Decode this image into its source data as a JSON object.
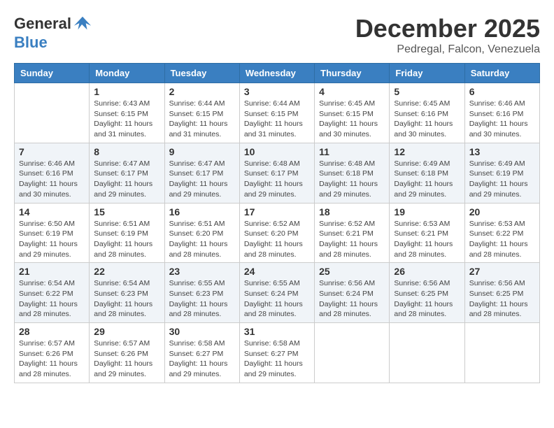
{
  "logo": {
    "general": "General",
    "blue": "Blue"
  },
  "title": {
    "month": "December 2025",
    "location": "Pedregal, Falcon, Venezuela"
  },
  "days_of_week": [
    "Sunday",
    "Monday",
    "Tuesday",
    "Wednesday",
    "Thursday",
    "Friday",
    "Saturday"
  ],
  "weeks": [
    [
      {
        "day": "",
        "info": ""
      },
      {
        "day": "1",
        "info": "Sunrise: 6:43 AM\nSunset: 6:15 PM\nDaylight: 11 hours and 31 minutes."
      },
      {
        "day": "2",
        "info": "Sunrise: 6:44 AM\nSunset: 6:15 PM\nDaylight: 11 hours and 31 minutes."
      },
      {
        "day": "3",
        "info": "Sunrise: 6:44 AM\nSunset: 6:15 PM\nDaylight: 11 hours and 31 minutes."
      },
      {
        "day": "4",
        "info": "Sunrise: 6:45 AM\nSunset: 6:15 PM\nDaylight: 11 hours and 30 minutes."
      },
      {
        "day": "5",
        "info": "Sunrise: 6:45 AM\nSunset: 6:16 PM\nDaylight: 11 hours and 30 minutes."
      },
      {
        "day": "6",
        "info": "Sunrise: 6:46 AM\nSunset: 6:16 PM\nDaylight: 11 hours and 30 minutes."
      }
    ],
    [
      {
        "day": "7",
        "info": "Sunrise: 6:46 AM\nSunset: 6:16 PM\nDaylight: 11 hours and 30 minutes."
      },
      {
        "day": "8",
        "info": "Sunrise: 6:47 AM\nSunset: 6:17 PM\nDaylight: 11 hours and 29 minutes."
      },
      {
        "day": "9",
        "info": "Sunrise: 6:47 AM\nSunset: 6:17 PM\nDaylight: 11 hours and 29 minutes."
      },
      {
        "day": "10",
        "info": "Sunrise: 6:48 AM\nSunset: 6:17 PM\nDaylight: 11 hours and 29 minutes."
      },
      {
        "day": "11",
        "info": "Sunrise: 6:48 AM\nSunset: 6:18 PM\nDaylight: 11 hours and 29 minutes."
      },
      {
        "day": "12",
        "info": "Sunrise: 6:49 AM\nSunset: 6:18 PM\nDaylight: 11 hours and 29 minutes."
      },
      {
        "day": "13",
        "info": "Sunrise: 6:49 AM\nSunset: 6:19 PM\nDaylight: 11 hours and 29 minutes."
      }
    ],
    [
      {
        "day": "14",
        "info": "Sunrise: 6:50 AM\nSunset: 6:19 PM\nDaylight: 11 hours and 29 minutes."
      },
      {
        "day": "15",
        "info": "Sunrise: 6:51 AM\nSunset: 6:19 PM\nDaylight: 11 hours and 28 minutes."
      },
      {
        "day": "16",
        "info": "Sunrise: 6:51 AM\nSunset: 6:20 PM\nDaylight: 11 hours and 28 minutes."
      },
      {
        "day": "17",
        "info": "Sunrise: 6:52 AM\nSunset: 6:20 PM\nDaylight: 11 hours and 28 minutes."
      },
      {
        "day": "18",
        "info": "Sunrise: 6:52 AM\nSunset: 6:21 PM\nDaylight: 11 hours and 28 minutes."
      },
      {
        "day": "19",
        "info": "Sunrise: 6:53 AM\nSunset: 6:21 PM\nDaylight: 11 hours and 28 minutes."
      },
      {
        "day": "20",
        "info": "Sunrise: 6:53 AM\nSunset: 6:22 PM\nDaylight: 11 hours and 28 minutes."
      }
    ],
    [
      {
        "day": "21",
        "info": "Sunrise: 6:54 AM\nSunset: 6:22 PM\nDaylight: 11 hours and 28 minutes."
      },
      {
        "day": "22",
        "info": "Sunrise: 6:54 AM\nSunset: 6:23 PM\nDaylight: 11 hours and 28 minutes."
      },
      {
        "day": "23",
        "info": "Sunrise: 6:55 AM\nSunset: 6:23 PM\nDaylight: 11 hours and 28 minutes."
      },
      {
        "day": "24",
        "info": "Sunrise: 6:55 AM\nSunset: 6:24 PM\nDaylight: 11 hours and 28 minutes."
      },
      {
        "day": "25",
        "info": "Sunrise: 6:56 AM\nSunset: 6:24 PM\nDaylight: 11 hours and 28 minutes."
      },
      {
        "day": "26",
        "info": "Sunrise: 6:56 AM\nSunset: 6:25 PM\nDaylight: 11 hours and 28 minutes."
      },
      {
        "day": "27",
        "info": "Sunrise: 6:56 AM\nSunset: 6:25 PM\nDaylight: 11 hours and 28 minutes."
      }
    ],
    [
      {
        "day": "28",
        "info": "Sunrise: 6:57 AM\nSunset: 6:26 PM\nDaylight: 11 hours and 28 minutes."
      },
      {
        "day": "29",
        "info": "Sunrise: 6:57 AM\nSunset: 6:26 PM\nDaylight: 11 hours and 29 minutes."
      },
      {
        "day": "30",
        "info": "Sunrise: 6:58 AM\nSunset: 6:27 PM\nDaylight: 11 hours and 29 minutes."
      },
      {
        "day": "31",
        "info": "Sunrise: 6:58 AM\nSunset: 6:27 PM\nDaylight: 11 hours and 29 minutes."
      },
      {
        "day": "",
        "info": ""
      },
      {
        "day": "",
        "info": ""
      },
      {
        "day": "",
        "info": ""
      }
    ]
  ]
}
